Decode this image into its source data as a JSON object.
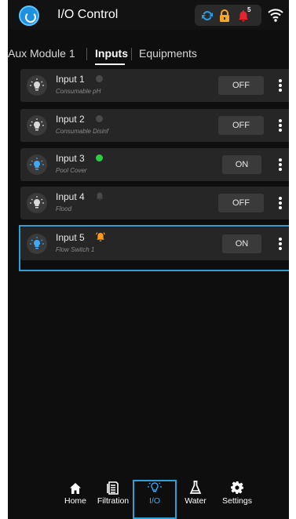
{
  "header": {
    "title": "I/O Control",
    "alarm_count": "5"
  },
  "tabs": [
    {
      "label": "Aux Module 1",
      "active": false
    },
    {
      "label": "Inputs",
      "active": true
    },
    {
      "label": "Equipments",
      "active": false
    }
  ],
  "inputs": [
    {
      "name": "Input 1",
      "subtitle": "Consumable pH",
      "state": "OFF",
      "indicator": "gray-dot"
    },
    {
      "name": "Input 2",
      "subtitle": "Consumable Disinf",
      "state": "OFF",
      "indicator": "gray-dot"
    },
    {
      "name": "Input 3",
      "subtitle": "Pool Cover",
      "state": "ON",
      "indicator": "green-dot"
    },
    {
      "name": "Input 4",
      "subtitle": "Flood",
      "state": "OFF",
      "indicator": "gray-alarm-icon"
    },
    {
      "name": "Input 5",
      "subtitle": "Flow Switch 1",
      "state": "ON",
      "indicator": "orange-alarm-icon"
    }
  ],
  "bottom_nav": [
    {
      "label": "Home",
      "icon": "home-icon"
    },
    {
      "label": "Filtration",
      "icon": "filtration-icon"
    },
    {
      "label": "I/O",
      "icon": "bulb-icon",
      "active": true
    },
    {
      "label": "Water",
      "icon": "flask-icon"
    },
    {
      "label": "Settings",
      "icon": "gear-icon"
    }
  ],
  "colors": {
    "accent_blue": "#2f9fd8",
    "on_green": "#2ecc40",
    "alarm_orange": "#ff9a1a",
    "alarm_red": "#e8232d",
    "lock_yellow": "#f5a623"
  }
}
